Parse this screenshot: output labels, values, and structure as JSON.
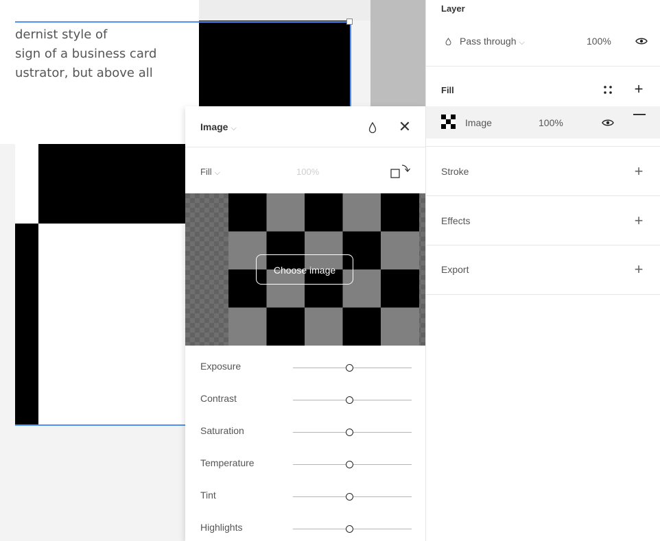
{
  "canvas": {
    "text_lines": [
      "dernist style of",
      "sign of a business card",
      "ustrator, but above all"
    ]
  },
  "image_popup": {
    "title": "Image",
    "fill_mode": "Fill",
    "opacity": "100%",
    "choose_image_label": "Choose image",
    "adjustments": [
      {
        "label": "Exposure",
        "value": 0
      },
      {
        "label": "Contrast",
        "value": 0
      },
      {
        "label": "Saturation",
        "value": 0
      },
      {
        "label": "Temperature",
        "value": 0
      },
      {
        "label": "Tint",
        "value": 0
      },
      {
        "label": "Highlights",
        "value": 0
      }
    ]
  },
  "properties": {
    "layer": {
      "title": "Layer",
      "blend_mode": "Pass through",
      "opacity": "100%"
    },
    "fill": {
      "title": "Fill",
      "item": {
        "type": "Image",
        "opacity": "100%"
      }
    },
    "stroke": {
      "title": "Stroke"
    },
    "effects": {
      "title": "Effects"
    },
    "export": {
      "title": "Export"
    }
  },
  "colors": {
    "selection": "#4f91f0",
    "checker_dark": "#000000",
    "checker_light": "#808080"
  }
}
